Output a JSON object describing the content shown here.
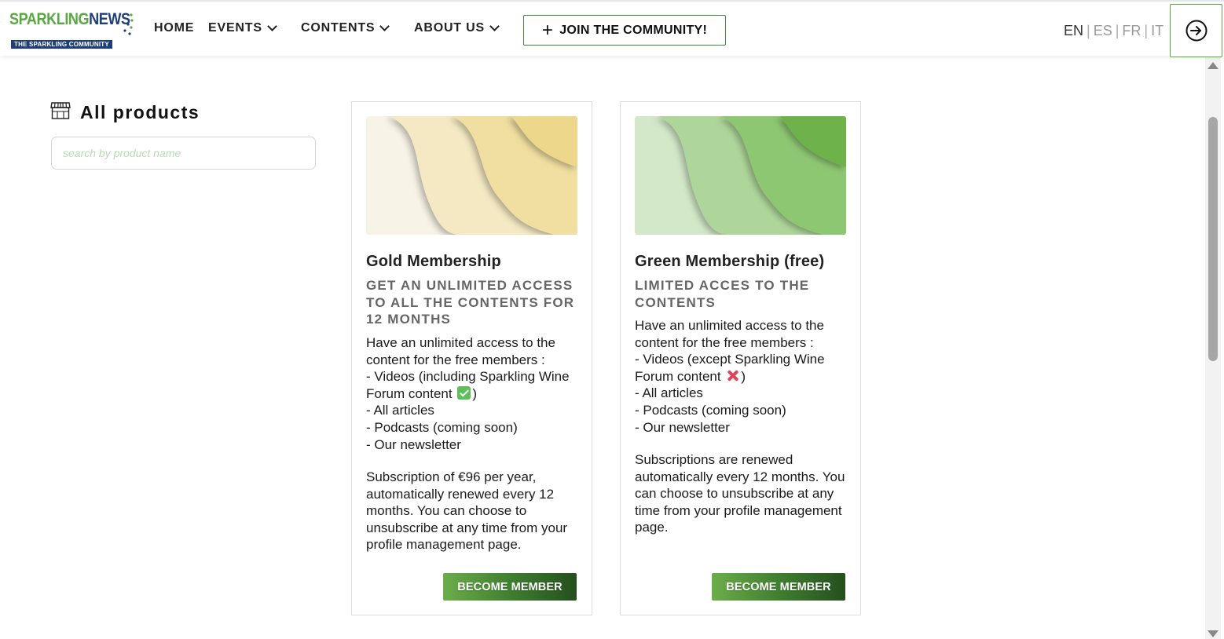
{
  "header": {
    "logo": {
      "name_part1": "SPARKLING",
      "name_part2": "NEWS",
      "tagline": "THE SPARKLING COMMUNITY"
    },
    "nav": [
      {
        "label": "HOME",
        "has_dropdown": false
      },
      {
        "label": "EVENTS",
        "has_dropdown": true
      },
      {
        "label": "CONTENTS",
        "has_dropdown": true
      },
      {
        "label": "ABOUT US",
        "has_dropdown": true
      }
    ],
    "join_button": "JOIN THE COMMUNITY!",
    "languages": [
      "EN",
      "ES",
      "FR",
      "IT"
    ],
    "active_language": "EN",
    "login_icon": "login-arrow-icon"
  },
  "sidebar": {
    "title": "All products",
    "title_icon": "store-icon",
    "search_placeholder": "search by product name",
    "search_value": ""
  },
  "products": [
    {
      "title": "Gold Membership",
      "subtitle": "GET AN UNLIMITED ACCESS TO ALL THE CONTENTS FOR 12 MONTHS",
      "description_line1": "Have an unlimited access to the content for the free members :",
      "description_line2": "- Videos (including Sparkling Wine Forum content",
      "status_icon": "check-mark-icon",
      "description_rest": ")\n- All articles\n- Podcasts (coming soon)\n- Our newsletter",
      "pricing": "Subscription of €96 per year, automatically renewed every 12 months. You can choose to unsubscribe at any time from your profile management page.",
      "button": "BECOME MEMBER",
      "theme_colors": [
        "#f7f3e6",
        "#f4e9c3",
        "#f0dfa0",
        "#ecd78a"
      ]
    },
    {
      "title": "Green Membership (free)",
      "subtitle": "LIMITED ACCES TO THE CONTENTS",
      "description_line1": "Have an unlimited access to the content for the free members :",
      "description_line2": "- Videos (except Sparkling Wine Forum content",
      "status_icon": "cross-mark-icon",
      "description_rest": ")\n- All articles\n- Podcasts (coming soon)\n- Our newsletter",
      "pricing": "Subscriptions are renewed automatically every 12 months. You can choose to unsubscribe at any time from your profile management page.",
      "button": "BECOME MEMBER",
      "theme_colors": [
        "#d2e8c8",
        "#aed69a",
        "#8ec772",
        "#6db348"
      ]
    }
  ],
  "colors": {
    "brand_green": "#5aa844",
    "brand_blue": "#1f3f7a",
    "button_green_dark": "#254f1e"
  }
}
